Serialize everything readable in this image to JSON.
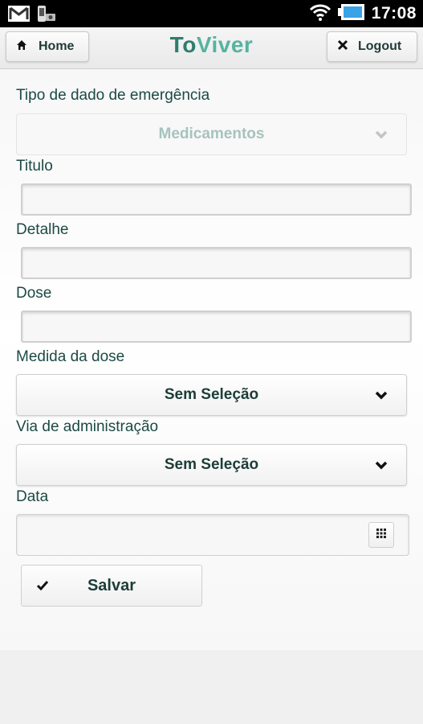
{
  "status_bar": {
    "time": "17:08",
    "icons": [
      "gmail-icon",
      "usb-debug-icon",
      "wifi-icon",
      "battery-icon"
    ]
  },
  "header": {
    "home_label": "Home",
    "logout_label": "Logout",
    "brand_to": "To",
    "brand_viver": "Viver"
  },
  "form": {
    "tipo": {
      "label": "Tipo de dado de emergência",
      "value": "Medicamentos"
    },
    "titulo": {
      "label": "Titulo",
      "value": ""
    },
    "detalhe": {
      "label": "Detalhe",
      "value": ""
    },
    "dose": {
      "label": "Dose",
      "value": ""
    },
    "medida": {
      "label": "Medida da dose",
      "value": "Sem Seleção"
    },
    "via": {
      "label": "Via de administração",
      "value": "Sem Seleção"
    },
    "data": {
      "label": "Data",
      "value": ""
    },
    "save_label": "Salvar"
  },
  "colors": {
    "accent_dark": "#2e7d6f",
    "accent_light": "#56b3a0",
    "text": "#1c4a44"
  }
}
